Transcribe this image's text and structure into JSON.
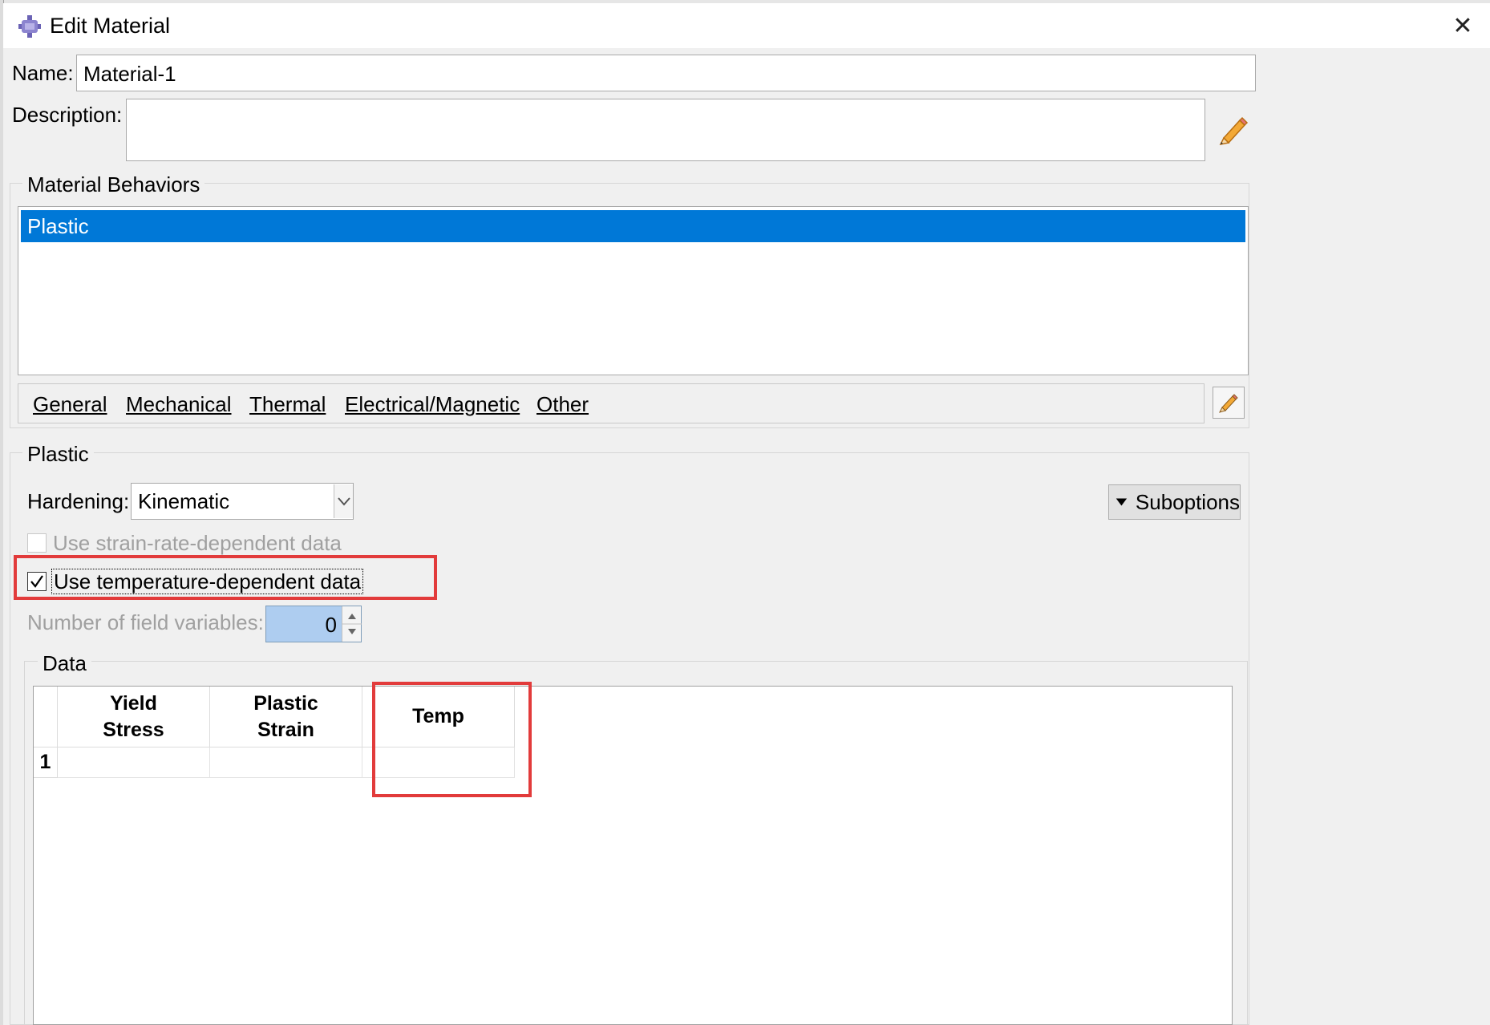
{
  "window": {
    "title": "Edit Material",
    "close_symbol": "✕",
    "icon": "abaqus-material-icon"
  },
  "name_field": {
    "label": "Name:",
    "value": "Material-1"
  },
  "description_field": {
    "label": "Description:",
    "value": "",
    "edit_icon": "pencil-icon"
  },
  "behaviors": {
    "title": "Material Behaviors",
    "items": [
      "Plastic"
    ],
    "selected": "Plastic"
  },
  "menu": {
    "items": [
      "General",
      "Mechanical",
      "Thermal",
      "Electrical/Magnetic",
      "Other"
    ],
    "edit_icon": "pencil-icon"
  },
  "plastic": {
    "title": "Plastic",
    "hardening_label": "Hardening:",
    "hardening_value": "Kinematic",
    "suboptions_label": "Suboptions",
    "strain_rate_label": "Use strain-rate-dependent data",
    "strain_rate_checked": false,
    "temp_label": "Use temperature-dependent data",
    "temp_checked": true,
    "field_vars_label": "Number of field variables:",
    "field_vars_value": "0"
  },
  "data_table": {
    "title": "Data",
    "columns": [
      "Yield\nStress",
      "Plastic\nStrain",
      "Temp"
    ],
    "rows": [
      {
        "index": "1",
        "cells": [
          "",
          "",
          ""
        ]
      }
    ]
  },
  "highlight_color": "#e23b3b",
  "selection_color": "#0078d7"
}
